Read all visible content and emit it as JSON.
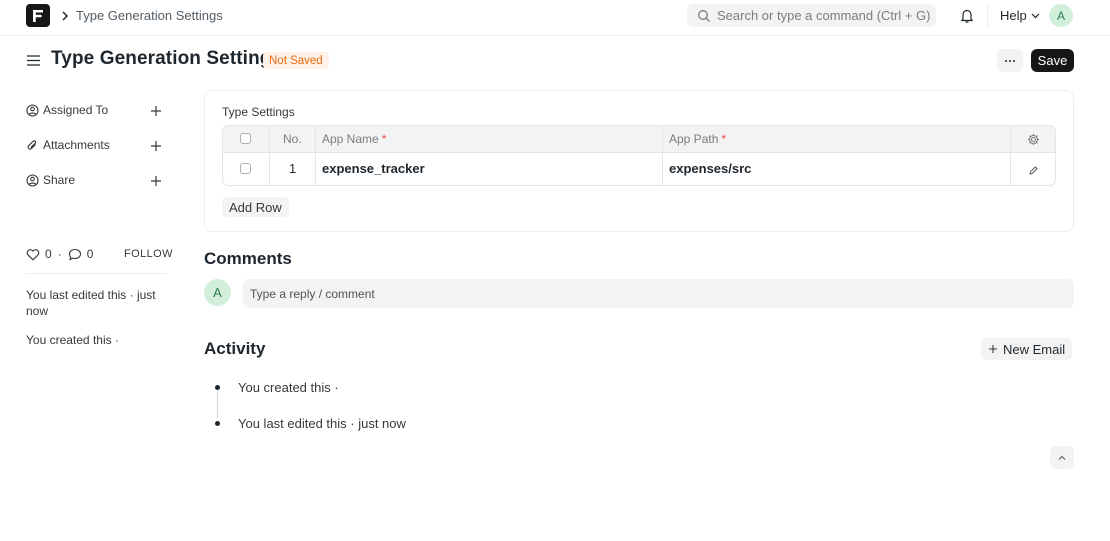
{
  "navbar": {
    "breadcrumb": "Type Generation Settings",
    "search_placeholder": "Search or type a command (Ctrl + G)",
    "help_label": "Help",
    "avatar_initial": "A"
  },
  "page": {
    "title": "Type Generation Settings",
    "status": "Not Saved",
    "save_label": "Save"
  },
  "sidebar": {
    "assigned_to": "Assigned To",
    "attachments": "Attachments",
    "share": "Share",
    "likes_count": "0",
    "comments_count": "0",
    "follow_label": "FOLLOW",
    "last_edited": "You last edited this · just now",
    "created": "You created this ·"
  },
  "settings": {
    "section_label": "Type Settings",
    "columns": {
      "no": "No.",
      "app_name": "App Name",
      "app_path": "App Path",
      "required_mark": "*"
    },
    "rows": [
      {
        "no": "1",
        "app_name": "expense_tracker",
        "app_path": "expenses/src"
      }
    ],
    "add_row_label": "Add Row"
  },
  "comments": {
    "title": "Comments",
    "avatar_initial": "A",
    "placeholder": "Type a reply / comment"
  },
  "activity": {
    "title": "Activity",
    "new_email_label": "New Email",
    "items": [
      "You created this ·",
      "You last edited this · just now"
    ]
  },
  "colors": {
    "primary_button": "#171717",
    "status_badge_bg": "#fff0e8",
    "status_badge_text": "#e86c13",
    "avatar_bg": "#d2efdc",
    "required": "#e24c4c"
  }
}
